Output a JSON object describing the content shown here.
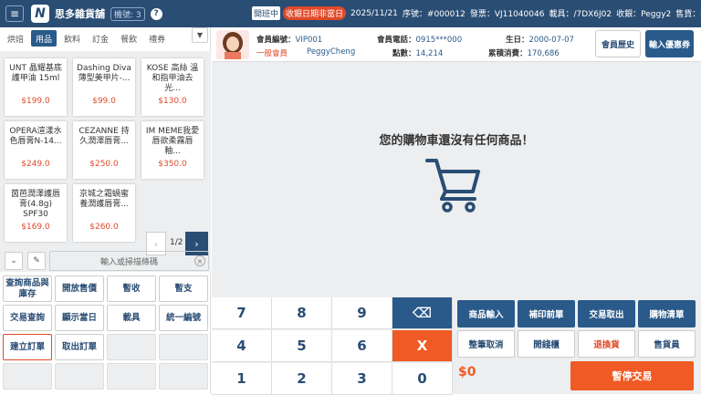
{
  "topbar": {
    "menu_icon": "hamburger-icon",
    "logo_letter": "N",
    "store_name": "思多雜貨舖",
    "station": "機號: 3",
    "help_label": "?",
    "open_status": "開班中",
    "date_warning": "收銀日期非當日",
    "date": "2025/11/21",
    "serial": "序號：#000012",
    "invoice": "發票：VJ11040046",
    "carrier": "載具：/7DX6J02",
    "cashier": "收銀：Peggy2",
    "seller": "售貨：未輸入"
  },
  "categories": {
    "items": [
      "烘焙",
      "用品",
      "飲料",
      "訂金",
      "餐飲",
      "禮券"
    ],
    "active_index": 1,
    "toggle_icon": "chevron-down-icon"
  },
  "products": [
    {
      "name": "UNT 晶耀基底護甲油 15ml",
      "price": "$199.0"
    },
    {
      "name": "Dashing Diva 薄型美甲片-...",
      "price": "$99.0"
    },
    {
      "name": "KOSE 高絲 溫和指甲油去光...",
      "price": "$130.0"
    },
    {
      "name": "OPERA渲漾水色唇膏N-14...",
      "price": "$249.0"
    },
    {
      "name": "CEZANNE 持久潤澤唇膏...",
      "price": "$250.0"
    },
    {
      "name": "IM MEME我愛唇欲柔霧唇釉...",
      "price": "$350.0"
    },
    {
      "name": "茵芭潤澤護唇膏(4.8g) SPF30",
      "price": "$169.0"
    },
    {
      "name": "京城之霜蝸蜜養潤護唇膏...",
      "price": "$260.0"
    }
  ],
  "pager": {
    "text": "1/2",
    "prev": "‹",
    "next": "›"
  },
  "search": {
    "placeholder": "輸入或掃描條碼",
    "clear": "×"
  },
  "functions": [
    "查詢商品與庫存",
    "開放售價",
    "暫收",
    "暫支",
    "交易查詢",
    "顯示當日",
    "載具",
    "統一編號",
    "建立訂單",
    "取出訂單",
    "",
    "",
    "",
    "",
    "",
    ""
  ],
  "member": {
    "no_label": "會員編號：",
    "no_value": "VIP001",
    "tier": "一般會員",
    "name": "PeggyCheng",
    "phone_label": "會員電話：",
    "phone_value": "0915***000",
    "points_label": "點數：",
    "points_value": "14,214",
    "birthday_label": "生日：",
    "birthday_value": "2000-07-07",
    "spend_label": "累積消費：",
    "spend_value": "170,686",
    "history_button": "會員歷史",
    "coupon_button": "輸入優惠券"
  },
  "cart": {
    "empty_message": "您的購物車還沒有任何商品！",
    "icon": "shopping-cart-icon"
  },
  "numpad": [
    "7",
    "8",
    "9",
    "⌫",
    "4",
    "5",
    "6",
    "X",
    "1",
    "2",
    "3",
    "0"
  ],
  "actions": {
    "row1": [
      "商品輸入",
      "補印前單",
      "交易取出",
      "購物清單"
    ],
    "row2": [
      "整筆取消",
      "開錢櫃",
      "退換貨",
      "售貨員"
    ],
    "total": "$0",
    "pause": "暫停交易"
  },
  "colors": {
    "primary": "#2a4d74",
    "accent": "#f05a24",
    "price": "#e04a2a"
  }
}
